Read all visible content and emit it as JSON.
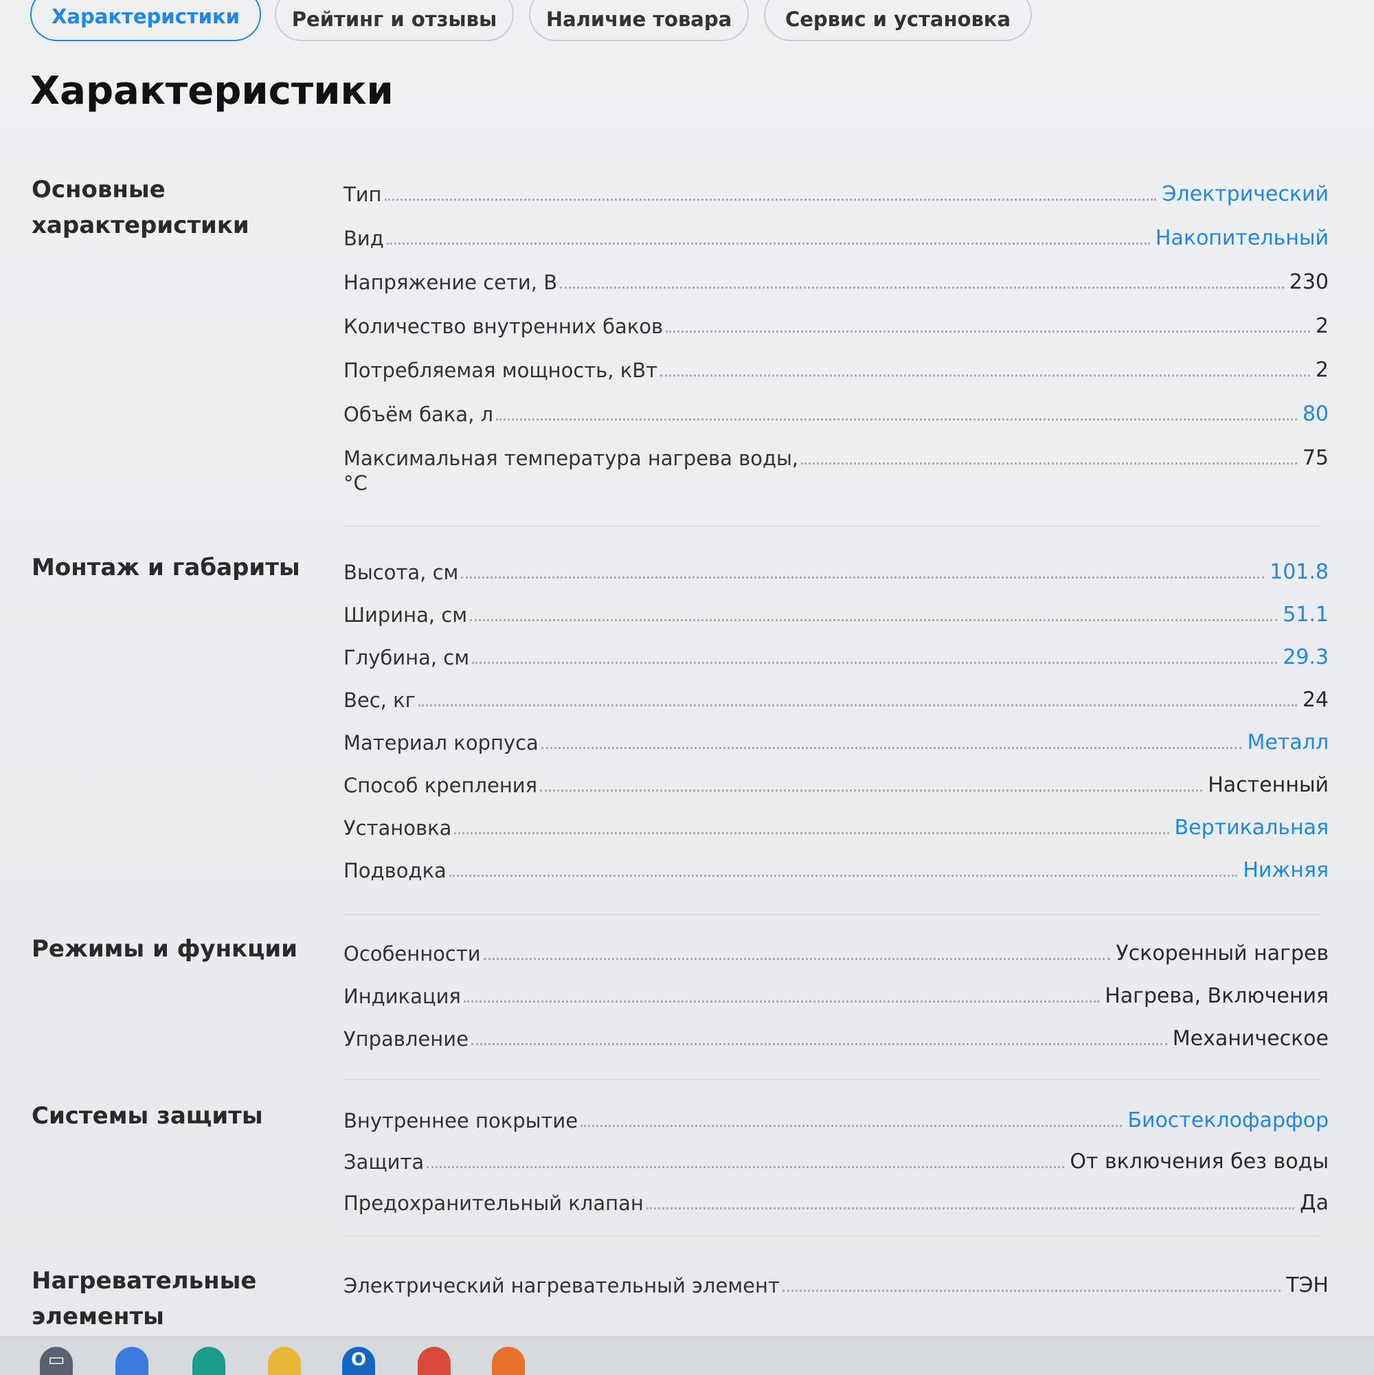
{
  "tabs": [
    {
      "label": "Характеристики",
      "active": true
    },
    {
      "label": "Рейтинг и отзывы",
      "active": false
    },
    {
      "label": "Наличие товара",
      "active": false
    },
    {
      "label": "Сервис и установка",
      "active": false
    }
  ],
  "page_title": "Характеристики",
  "sections": [
    {
      "title": "Основные характеристики",
      "rows": [
        {
          "label": "Тип",
          "value": "Электрический",
          "link": true
        },
        {
          "label": "Вид",
          "value": "Накопительный",
          "link": true
        },
        {
          "label": "Напряжение сети, В",
          "value": "230",
          "link": false
        },
        {
          "label": "Количество внутренних баков",
          "value": "2",
          "link": false
        },
        {
          "label": "Потребляемая мощность, кВт",
          "value": "2",
          "link": false
        },
        {
          "label": "Объём бака, л",
          "value": "80",
          "link": true
        },
        {
          "label": "Максимальная температура нагрева воды,",
          "label_cont": "°C",
          "value": "75",
          "link": false
        }
      ]
    },
    {
      "title": "Монтаж и габариты",
      "rows": [
        {
          "label": "Высота, см",
          "value": "101.8",
          "link": true
        },
        {
          "label": "Ширина, см",
          "value": "51.1",
          "link": true
        },
        {
          "label": "Глубина, см",
          "value": "29.3",
          "link": true
        },
        {
          "label": "Вес, кг",
          "value": "24",
          "link": false
        },
        {
          "label": "Материал корпуса",
          "value": "Металл",
          "link": true
        },
        {
          "label": "Способ крепления",
          "value": "Настенный",
          "link": false
        },
        {
          "label": "Установка",
          "value": "Вертикальная",
          "link": true
        },
        {
          "label": "Подводка",
          "value": "Нижняя",
          "link": true
        }
      ]
    },
    {
      "title": "Режимы и функции",
      "rows": [
        {
          "label": "Особенности",
          "value": "Ускоренный нагрев",
          "link": false
        },
        {
          "label": "Индикация",
          "value": "Нагрева, Включения",
          "link": false
        },
        {
          "label": "Управление",
          "value": "Механическое",
          "link": false
        }
      ]
    },
    {
      "title": "Системы защиты",
      "rows": [
        {
          "label": "Внутреннее покрытие",
          "value": "Биостеклофарфор",
          "link": true
        },
        {
          "label": "Защита",
          "value": "От включения без воды",
          "link": false
        },
        {
          "label": "Предохранительный клапан",
          "value": "Да",
          "link": false
        }
      ]
    },
    {
      "title": "Нагревательные элементы",
      "rows": [
        {
          "label": "Электрический нагревательный элемент",
          "value": "ТЭН",
          "link": false
        }
      ]
    }
  ],
  "taskbar": {
    "icons": [
      {
        "name": "task-view-icon",
        "color": "#5a6270",
        "glyph": "▭"
      },
      {
        "name": "copilot-icon",
        "color": "#3b7be0",
        "glyph": ""
      },
      {
        "name": "edge-icon",
        "color": "#1a9c8a",
        "glyph": ""
      },
      {
        "name": "file-explorer-icon",
        "color": "#e8b83a",
        "glyph": ""
      },
      {
        "name": "outlook-icon",
        "color": "#1466c4",
        "glyph": "O"
      },
      {
        "name": "chrome-icon",
        "color": "#d94a3a",
        "glyph": ""
      },
      {
        "name": "firefox-icon",
        "color": "#e8702a",
        "glyph": ""
      }
    ]
  }
}
